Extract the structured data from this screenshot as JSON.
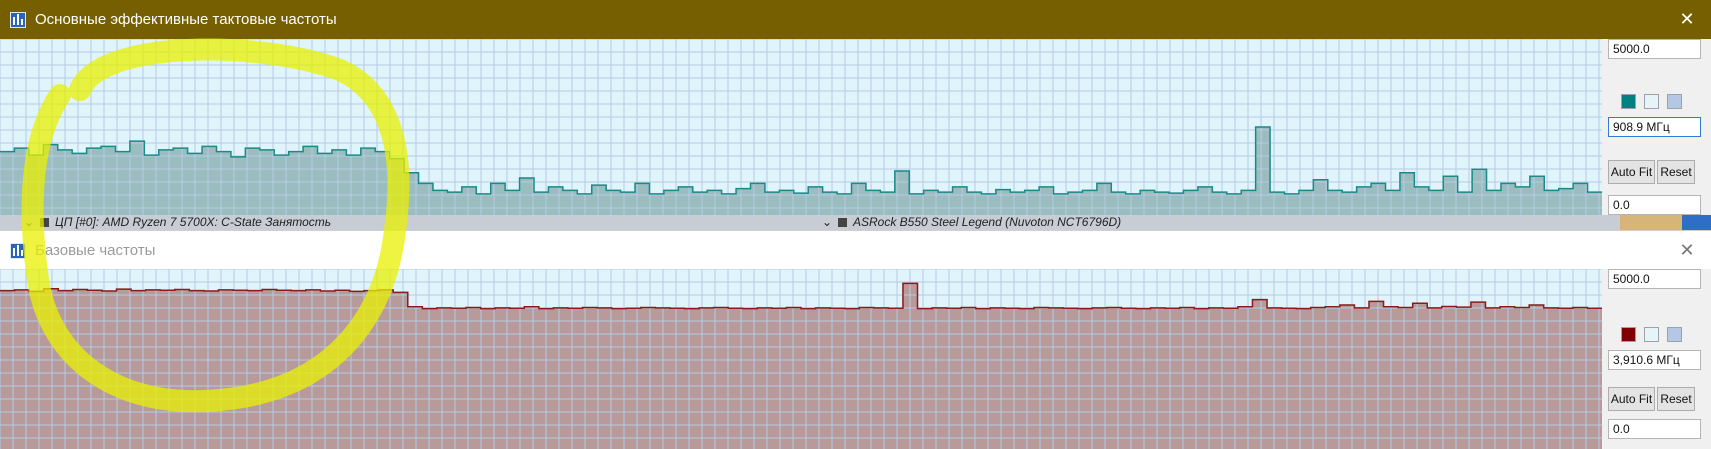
{
  "window_top": {
    "title": "Основные эффективные тактовые частоты",
    "max_value": "5000.0",
    "current_value": "908.9 МГц",
    "min_value": "0.0",
    "auto_fit_label": "Auto Fit",
    "reset_label": "Reset",
    "line_color": "#1a8a86",
    "fill_color": "#9bbdc0",
    "background_color": "#dff5fb",
    "swatches": [
      "#008080",
      "#e6f4f8",
      "#b4c8e6"
    ]
  },
  "window_bottom": {
    "title": "Базовые частоты",
    "max_value": "5000.0",
    "current_value": "3,910.6 МГц",
    "min_value": "0.0",
    "auto_fit_label": "Auto Fit",
    "reset_label": "Reset",
    "line_color": "#8b1a1a",
    "fill_color": "#b99a9b",
    "background_color": "#dff5fb",
    "swatches": [
      "#800000",
      "#e6f4f8",
      "#b4c8e6"
    ]
  },
  "background_strip": {
    "left_label": "ЦП [#0]: AMD Ryzen 7 5700X: C-State Занятость",
    "right_label": "ASRock B550 Steel Legend (Nuvoton NCT6796D)"
  },
  "chart_data": [
    {
      "type": "area",
      "title": "Основные эффективные тактовые частоты",
      "unit": "МГц",
      "ylim": [
        0,
        5000
      ],
      "grid": true,
      "description_values": "sampled history; approx 1600-2000 MHz in early samples, then approx 500-1000 MHz with spikes",
      "values": [
        1800,
        1900,
        1700,
        2000,
        1850,
        1750,
        1900,
        1950,
        1800,
        2100,
        1700,
        1850,
        1900,
        1750,
        1950,
        1800,
        1650,
        1900,
        1850,
        1700,
        1800,
        1950,
        1750,
        1850,
        1700,
        1900,
        1800,
        1600,
        1200,
        900,
        700,
        650,
        800,
        600,
        900,
        700,
        1050,
        650,
        800,
        700,
        600,
        850,
        700,
        650,
        900,
        600,
        700,
        800,
        650,
        700,
        600,
        750,
        900,
        650,
        700,
        620,
        800,
        650,
        600,
        900,
        700,
        650,
        1250,
        600,
        700,
        650,
        800,
        650,
        600,
        720,
        650,
        700,
        800,
        600,
        650,
        700,
        900,
        650,
        600,
        700,
        650,
        620,
        700,
        800,
        650,
        600,
        700,
        2500,
        650,
        600,
        700,
        1000,
        700,
        650,
        800,
        900,
        700,
        1200,
        800,
        700,
        1100,
        650,
        1300,
        700,
        900,
        800,
        1100,
        700,
        750,
        900,
        650
      ]
    },
    {
      "type": "area",
      "title": "Базовые частоты",
      "unit": "МГц",
      "ylim": [
        0,
        5000
      ],
      "grid": true,
      "values": [
        4400,
        4420,
        4380,
        4450,
        4400,
        4430,
        4410,
        4390,
        4440,
        4400,
        4420,
        4410,
        4430,
        4400,
        4390,
        4420,
        4410,
        4400,
        4430,
        4410,
        4400,
        4420,
        4390,
        4410,
        4380,
        4400,
        4420,
        4350,
        3950,
        3900,
        3920,
        3910,
        3930,
        3900,
        3920,
        3910,
        3950,
        3900,
        3920,
        3910,
        3930,
        3920,
        3900,
        3910,
        3930,
        3920,
        3910,
        3900,
        3920,
        3930,
        3910,
        3900,
        3920,
        3910,
        3930,
        3900,
        3920,
        3910,
        3900,
        3930,
        3920,
        3910,
        4600,
        3900,
        3920,
        3910,
        3930,
        3900,
        3920,
        3910,
        3900,
        3930,
        3920,
        3910,
        3900,
        3920,
        3930,
        3910,
        3900,
        3920,
        3910,
        3930,
        3900,
        3920,
        3910,
        3950,
        4150,
        3920,
        3910,
        3900,
        3930,
        3950,
        4000,
        3920,
        4100,
        3950,
        3930,
        4050,
        3920,
        3960,
        3940,
        4080,
        3920,
        3950,
        3930,
        4000,
        3920,
        3910,
        3930,
        3910
      ]
    }
  ]
}
